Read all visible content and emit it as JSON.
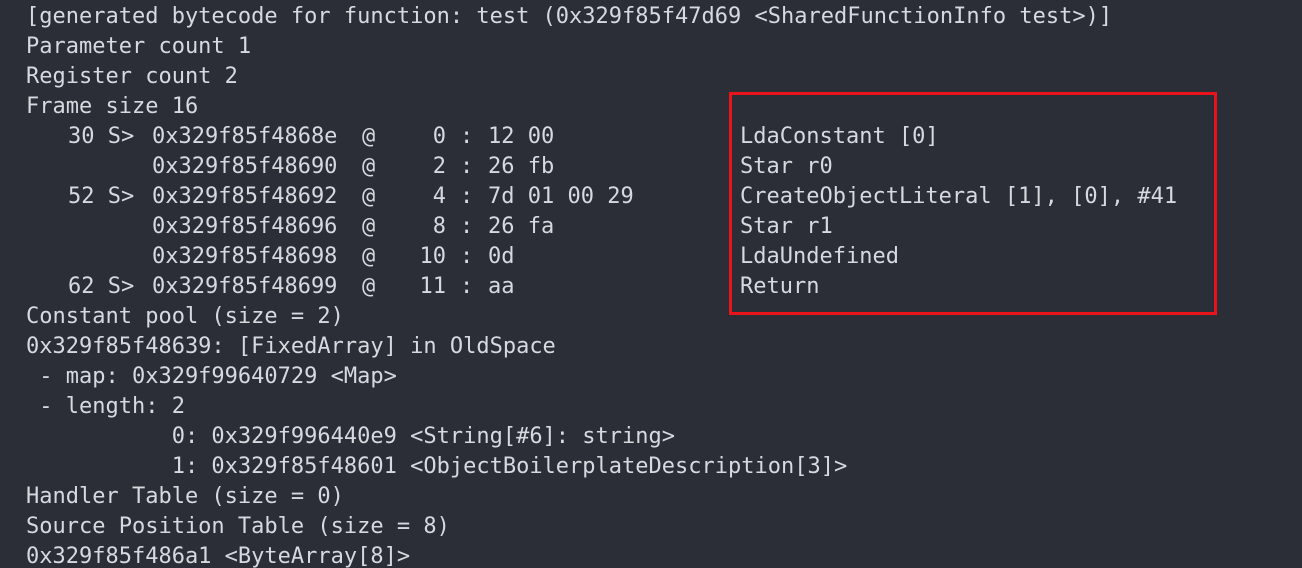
{
  "header": [
    "[generated bytecode for function: test (0x329f85f47d69 <SharedFunctionInfo test>)]",
    "Parameter count 1",
    "Register count 2",
    "Frame size 16"
  ],
  "bytecode": [
    {
      "src": "30 S>",
      "addr": "0x329f85f4868e",
      "at": "@",
      "offset": "0",
      "sep": ":",
      "bytes": "12 00",
      "instr": "LdaConstant [0]"
    },
    {
      "src": "",
      "addr": "0x329f85f48690",
      "at": "@",
      "offset": "2",
      "sep": ":",
      "bytes": "26 fb",
      "instr": "Star r0"
    },
    {
      "src": "52 S>",
      "addr": "0x329f85f48692",
      "at": "@",
      "offset": "4",
      "sep": ":",
      "bytes": "7d 01 00 29",
      "instr": "CreateObjectLiteral [1], [0], #41"
    },
    {
      "src": "",
      "addr": "0x329f85f48696",
      "at": "@",
      "offset": "8",
      "sep": ":",
      "bytes": "26 fa",
      "instr": "Star r1"
    },
    {
      "src": "",
      "addr": "0x329f85f48698",
      "at": "@",
      "offset": "10",
      "sep": ":",
      "bytes": "0d",
      "instr": "LdaUndefined"
    },
    {
      "src": "62 S>",
      "addr": "0x329f85f48699",
      "at": "@",
      "offset": "11",
      "sep": ":",
      "bytes": "aa",
      "instr": "Return"
    }
  ],
  "footer": [
    "Constant pool (size = 2)",
    "0x329f85f48639: [FixedArray] in OldSpace",
    " - map: 0x329f99640729 <Map>",
    " - length: 2",
    "           0: 0x329f996440e9 <String[#6]: string>",
    "           1: 0x329f85f48601 <ObjectBoilerplateDescription[3]>",
    "Handler Table (size = 0)",
    "Source Position Table (size = 8)",
    "0x329f85f486a1 <ByteArray[8]>"
  ],
  "colors": {
    "background": "#2b2e37",
    "text": "#d6d9de",
    "highlight": "#e8131b"
  }
}
